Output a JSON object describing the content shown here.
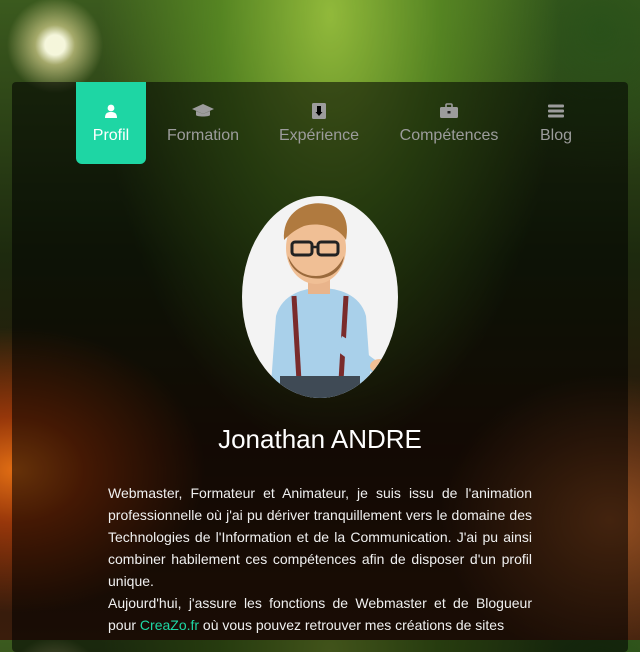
{
  "tabs": [
    {
      "label": "Profil",
      "icon": "user-icon",
      "active": true
    },
    {
      "label": "Formation",
      "icon": "graduation-cap-icon",
      "active": false
    },
    {
      "label": "Expérience",
      "icon": "badge-icon",
      "active": false
    },
    {
      "label": "Compétences",
      "icon": "briefcase-icon",
      "active": false
    },
    {
      "label": "Blog",
      "icon": "menu-icon",
      "active": false
    }
  ],
  "profile": {
    "avatar": "cartoon-avatar",
    "name": "Jonathan ANDRE",
    "bio_p1": "Webmaster, Formateur et Animateur, je suis issu de l'animation professionnelle où j'ai pu dériver tranquillement vers le domaine des Technologies de l'Information et de la Communication. J'ai pu ainsi combiner habilement ces compétences afin de disposer d'un profil unique.",
    "bio_p2_before": "Aujourd'hui, j'assure les fonctions de Webmaster et de Blogueur pour ",
    "bio_p2_link": "CreaZo.fr",
    "bio_p2_after": " où vous pouvez retrouver mes créations de sites"
  },
  "colors": {
    "accent": "#1ed6a4",
    "tab_inactive": "#9c9c9c"
  }
}
